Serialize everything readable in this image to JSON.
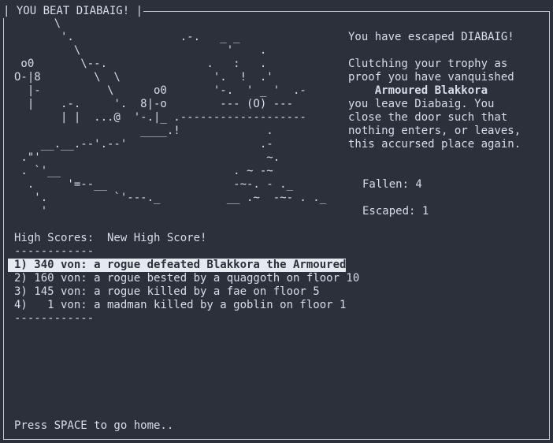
{
  "window": {
    "title": "| YOU BEAT DIABAIG! |"
  },
  "art": "      \\\n       '.                .-.   _ _\n         \\                      '    .\n o0       \\--.               .   :   .\nO-|8        \\  \\              '.  !  .'\n  |-          \\      o0       '-.  ' _ '  .-\n  |    .-.     '.  8|-o        --- (O) ---\n       | |  ...@  '-.|_ .-------------------\n                   ____.!             .\n    __.__.--'.--'                    .-\n .\"'                                  ~.\n . `'__                          . ~ -~\n  .     '=--__                   -~-. - ._\n   '.          `'---._          __ .~  -~- . ._\n    '",
  "message": {
    "line1": "You have escaped DIABAIG!",
    "line2": "Clutching your trophy as",
    "line3": "proof you have vanquished",
    "boss_name": "Armoured Blakkora",
    "line5": "you leave Diabaig. You",
    "line6": "close the door such that",
    "line7": "nothing enters, or leaves,",
    "line8": "this accursed place again."
  },
  "stats": {
    "fallen_label": "Fallen: 4",
    "escaped_label": "Escaped: 1"
  },
  "scores": {
    "heading": "High Scores:  New High Score!",
    "rule_top": "------------",
    "rule_bottom": "------------",
    "entries": [
      "1) 340 von: a rogue defeated Blakkora the Armoured",
      "2) 160 von: a rogue bested by a quaggoth on floor 10",
      "3) 145 von: a rogue killed by a fae on floor 5",
      "4)   1 von: a madman killed by a goblin on floor 1"
    ],
    "highlight_index": 0
  },
  "footer": {
    "prompt": "Press SPACE to go home.."
  },
  "colors": {
    "background": "#2b303b",
    "foreground": "#d8dee9",
    "highlight_bg": "#e5e9f0"
  }
}
